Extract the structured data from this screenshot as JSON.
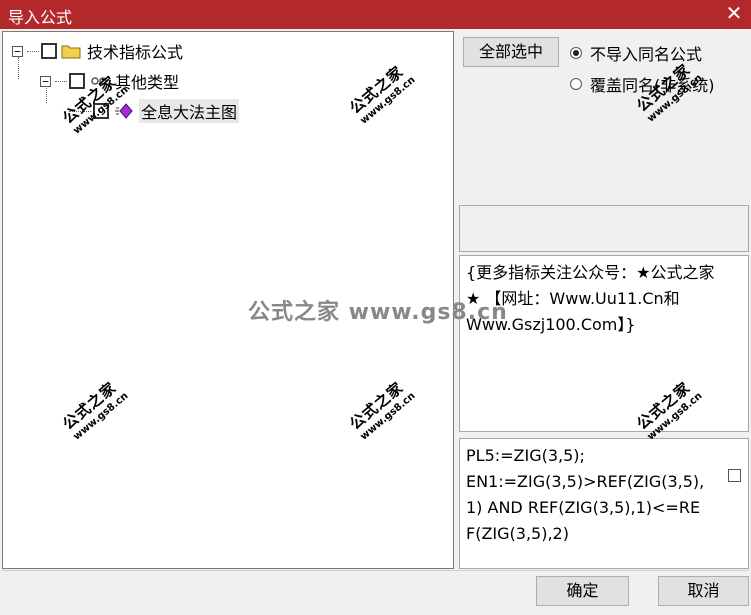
{
  "window": {
    "title": "导入公式",
    "close_glyph": "✕"
  },
  "tree": {
    "root": {
      "label": "技术指标公式",
      "expander": "−"
    },
    "group": {
      "label": "其他类型",
      "expander": "−"
    },
    "item": {
      "label": "全息大法主图"
    }
  },
  "buttons": {
    "select_all": "全部选中",
    "ok": "确定",
    "cancel": "取消"
  },
  "options": {
    "no_import_same": "不导入同名公式",
    "overwrite_same": "覆盖同名(非系统)"
  },
  "info": {
    "text": "{更多指标关注公众号：★公式之家★ 【网址：Www.Uu11.Cn和Www.Gszj100.Com】}"
  },
  "code": {
    "text": "PL5:=ZIG(3,5);\nEN1:=ZIG(3,5)>REF(ZIG(3,5),1) AND REF(ZIG(3,5),1)<=REF(ZIG(3,5),2)"
  },
  "watermark": {
    "top": "公式之家",
    "bottom": "www.gs8.cn",
    "center": "公式之家 www.gs8.cn"
  },
  "colors": {
    "titlebar": "#b3292b",
    "folder": "#f2d04b",
    "diamond": "#9b30d9"
  }
}
